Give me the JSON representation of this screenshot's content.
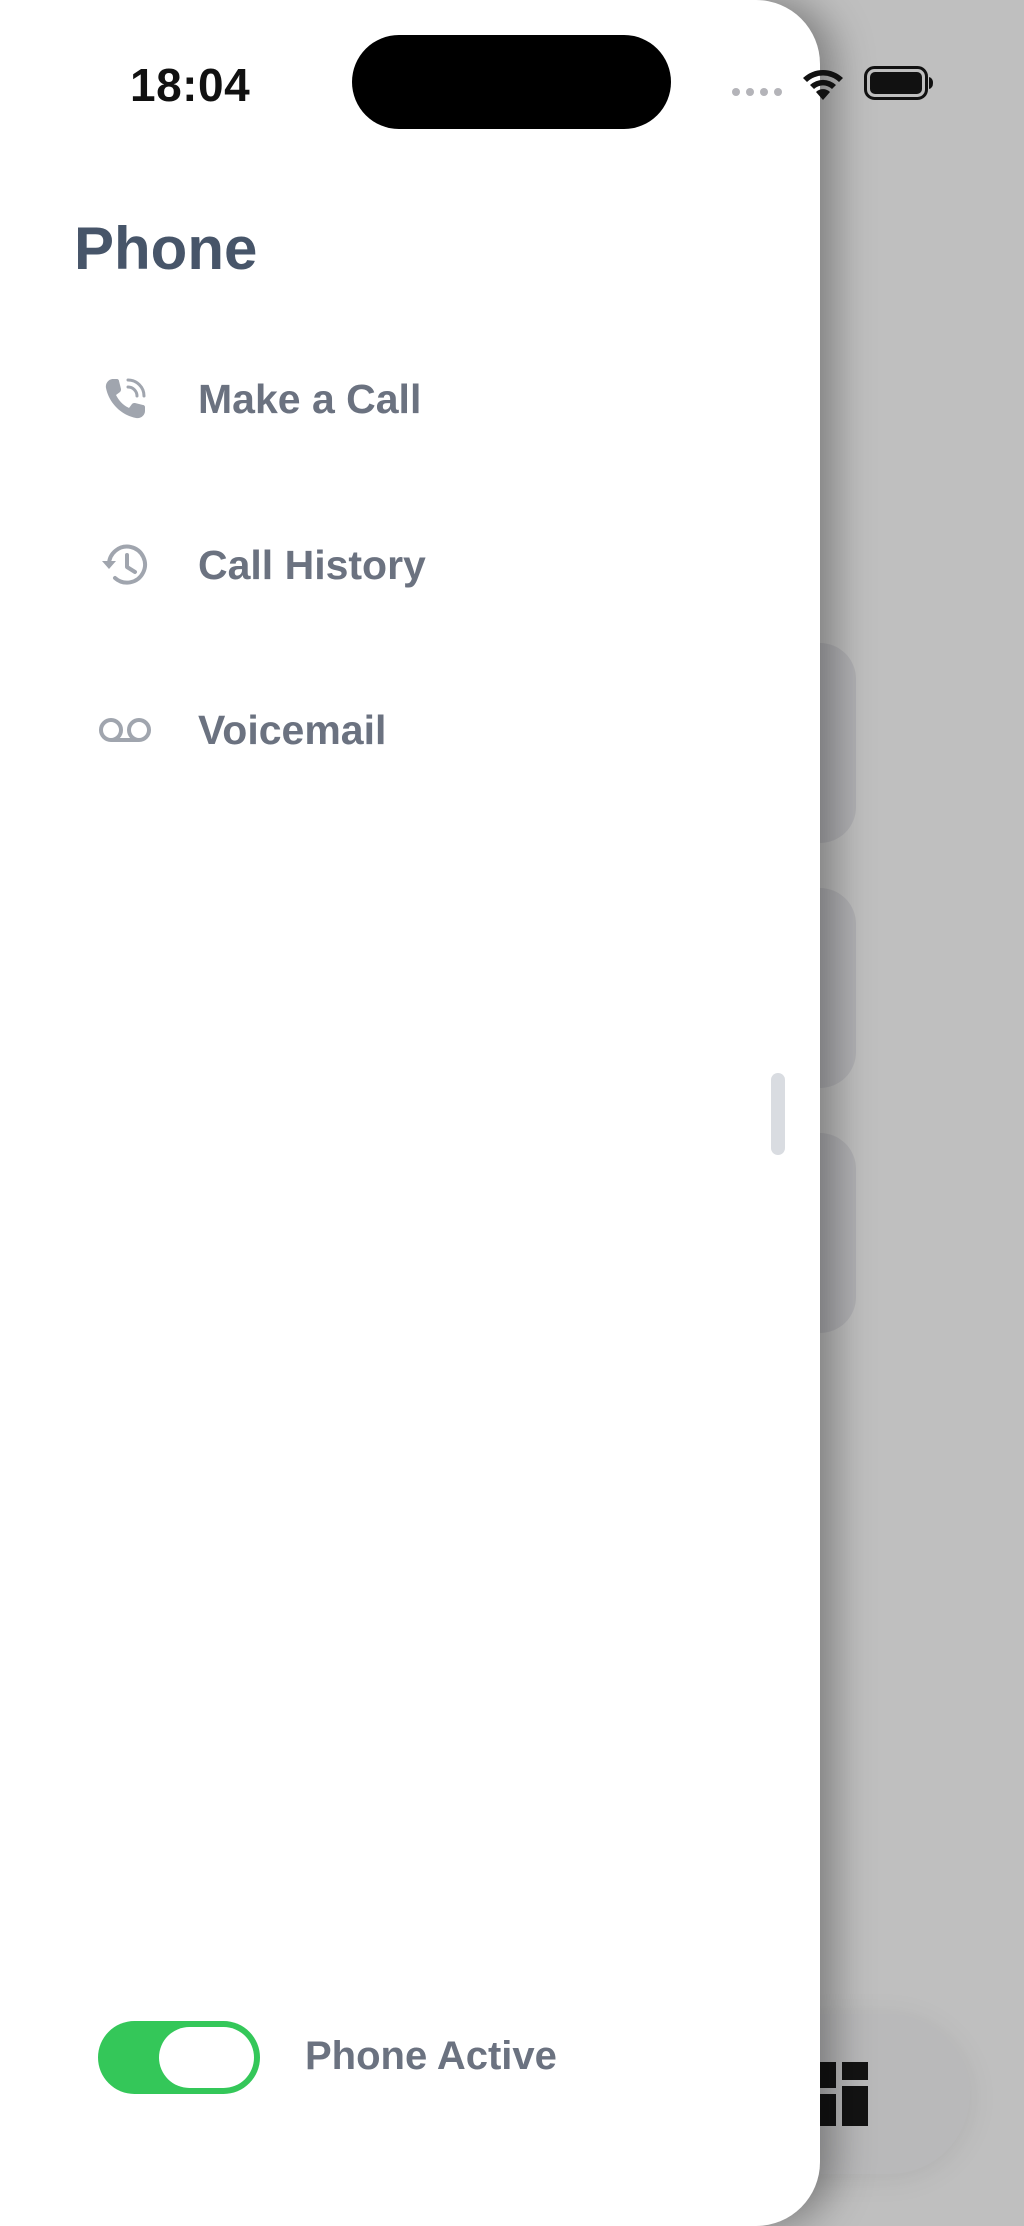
{
  "status_bar": {
    "time": "18:04"
  },
  "drawer": {
    "title": "Phone",
    "items": [
      {
        "label": "Make a Call",
        "icon": "phone-call-icon"
      },
      {
        "label": "Call History",
        "icon": "history-icon"
      },
      {
        "label": "Voicemail",
        "icon": "voicemail-icon"
      }
    ],
    "toggle": {
      "label": "Phone Active",
      "state": "on"
    }
  },
  "colors": {
    "title": "#475569",
    "item_text": "#6b7280",
    "icon": "#a0a5ae",
    "toggle_on": "#34c759"
  }
}
